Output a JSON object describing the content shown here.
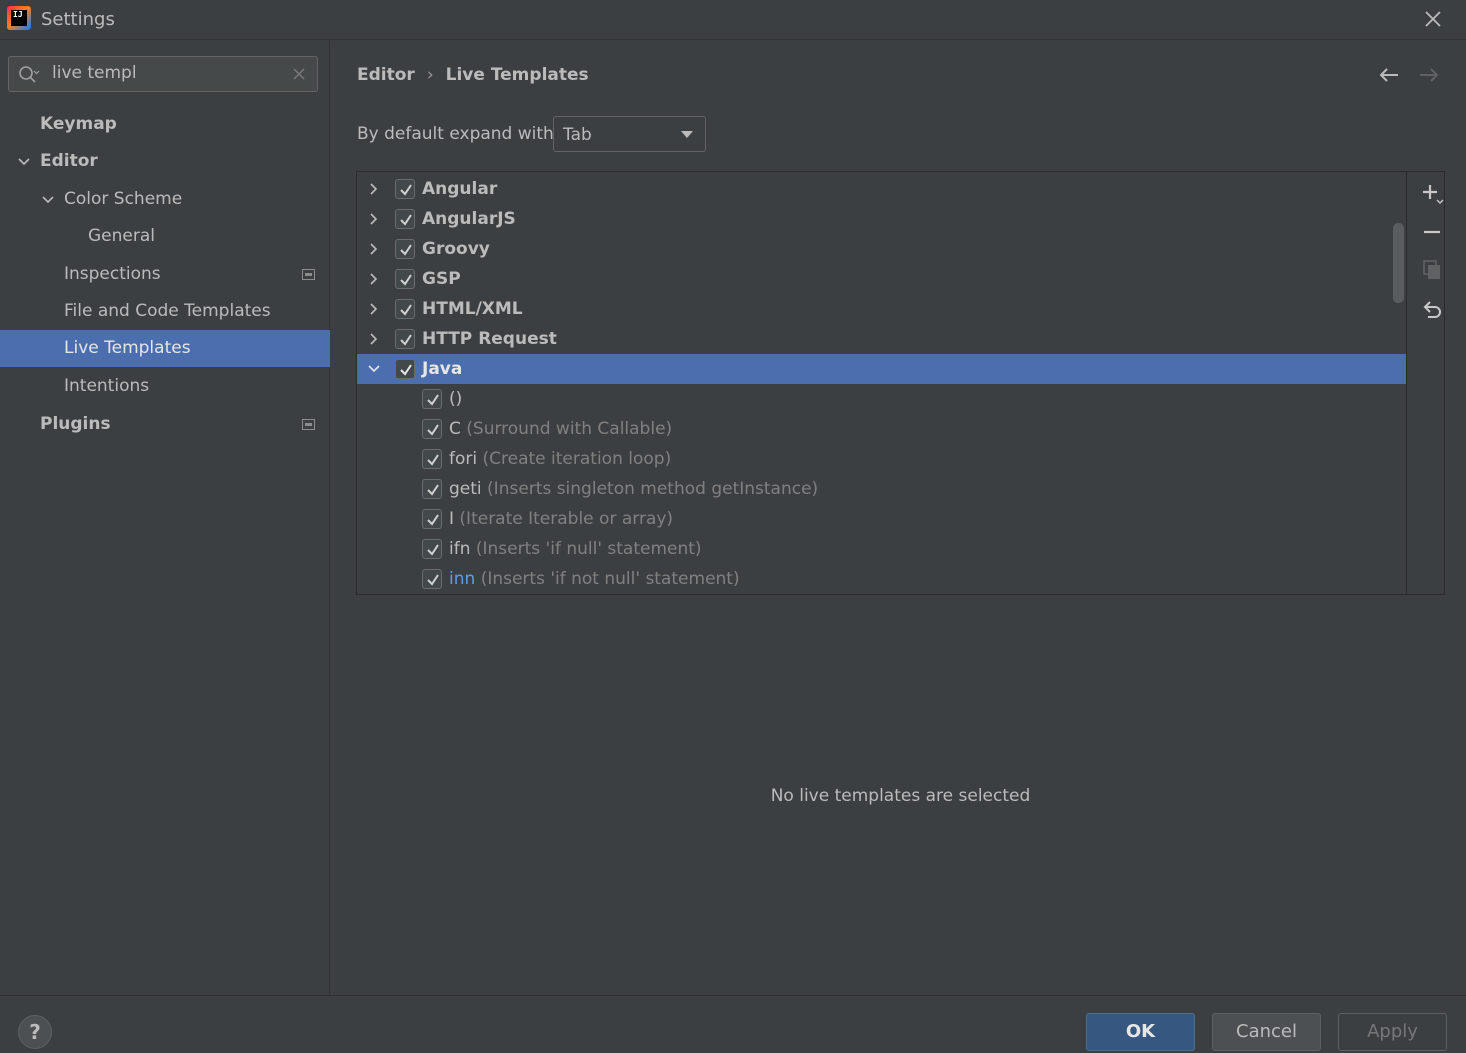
{
  "window": {
    "title": "Settings"
  },
  "search": {
    "value": "live templ"
  },
  "sidebar": {
    "items": [
      {
        "label": "Keymap"
      },
      {
        "label": "Editor"
      },
      {
        "label": "Color Scheme"
      },
      {
        "label": "General"
      },
      {
        "label": "Inspections"
      },
      {
        "label": "File and Code Templates"
      },
      {
        "label": "Live Templates"
      },
      {
        "label": "Intentions"
      },
      {
        "label": "Plugins"
      }
    ]
  },
  "breadcrumb": {
    "parent": "Editor",
    "current": "Live Templates"
  },
  "expand": {
    "label": "By default expand with",
    "value": "Tab"
  },
  "tree": {
    "groups": [
      {
        "name": "Angular",
        "checked": true,
        "expanded": false
      },
      {
        "name": "AngularJS",
        "checked": true,
        "expanded": false
      },
      {
        "name": "Groovy",
        "checked": true,
        "expanded": false
      },
      {
        "name": "GSP",
        "checked": true,
        "expanded": false
      },
      {
        "name": "HTML/XML",
        "checked": true,
        "expanded": false
      },
      {
        "name": "HTTP Request",
        "checked": true,
        "expanded": false
      },
      {
        "name": "Java",
        "checked": true,
        "expanded": true,
        "selected": true
      }
    ],
    "templates": [
      {
        "abbr": "()",
        "desc": ""
      },
      {
        "abbr": "C",
        "desc": "(Surround with Callable)"
      },
      {
        "abbr": "fori",
        "desc": "(Create iteration loop)"
      },
      {
        "abbr": "geti",
        "desc": "(Inserts singleton method getInstance)"
      },
      {
        "abbr": "I",
        "desc": "(Iterate Iterable or array)"
      },
      {
        "abbr": "ifn",
        "desc": "(Inserts 'if null' statement)"
      },
      {
        "abbr": "inn",
        "desc": "(Inserts 'if not null' statement)"
      }
    ]
  },
  "empty_message": "No live templates are selected",
  "buttons": {
    "help": "?",
    "ok": "OK",
    "cancel": "Cancel",
    "apply": "Apply"
  },
  "colors": {
    "background": "#3c3f41",
    "selection": "#4b6eaf",
    "ok_button": "#365880",
    "link": "#589df6"
  }
}
